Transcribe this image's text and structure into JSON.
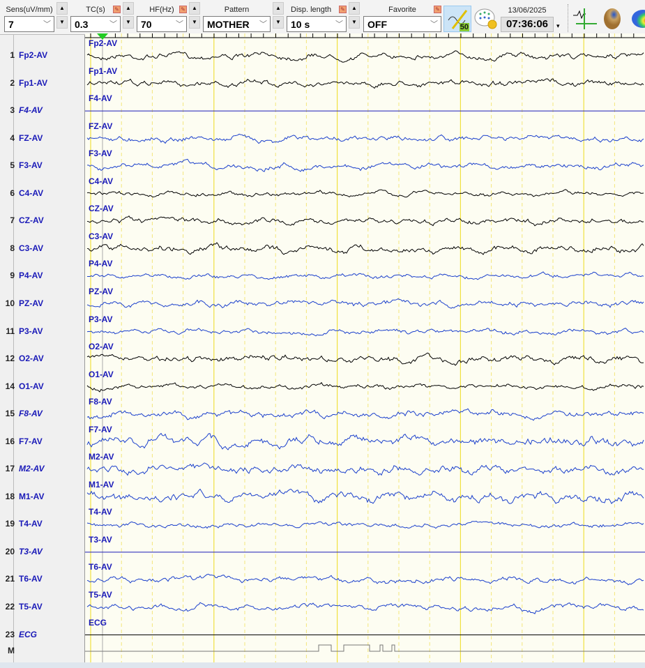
{
  "toolbar": {
    "sens": {
      "label": "Sens(uV/mm)",
      "value": "7"
    },
    "tc": {
      "label": "TC(s)",
      "value": "0.3"
    },
    "hf": {
      "label": "HF(Hz)",
      "value": "70"
    },
    "pattern": {
      "label": "Pattern",
      "value": "MOTHER"
    },
    "disp": {
      "label": "Disp. length",
      "value": "10 s"
    },
    "favorite": {
      "label": "Favorite",
      "value": "OFF"
    },
    "notch": "50",
    "date": "13/06/2025",
    "time": "07:36:06"
  },
  "channels": [
    {
      "num": "1",
      "name": "Fp2-AV",
      "trace": "Fp2-AV",
      "italic": false,
      "color": "#000000",
      "amp": 5
    },
    {
      "num": "2",
      "name": "Fp1-AV",
      "trace": "Fp1-AV",
      "italic": false,
      "color": "#000000",
      "amp": 5
    },
    {
      "num": "3",
      "name": "F4-AV",
      "trace": "F4-AV",
      "italic": true,
      "color": "#1a1ab8",
      "amp": 0
    },
    {
      "num": "4",
      "name": "FZ-AV",
      "trace": "FZ-AV",
      "italic": false,
      "color": "#1a3fcc",
      "amp": 5
    },
    {
      "num": "5",
      "name": "F3-AV",
      "trace": "F3-AV",
      "italic": false,
      "color": "#1a3fcc",
      "amp": 5
    },
    {
      "num": "6",
      "name": "C4-AV",
      "trace": "C4-AV",
      "italic": false,
      "color": "#000000",
      "amp": 4
    },
    {
      "num": "7",
      "name": "CZ-AV",
      "trace": "CZ-AV",
      "italic": false,
      "color": "#000000",
      "amp": 5
    },
    {
      "num": "8",
      "name": "C3-AV",
      "trace": "C3-AV",
      "italic": false,
      "color": "#000000",
      "amp": 6
    },
    {
      "num": "9",
      "name": "P4-AV",
      "trace": "P4-AV",
      "italic": false,
      "color": "#1a3fcc",
      "amp": 4
    },
    {
      "num": "10",
      "name": "PZ-AV",
      "trace": "PZ-AV",
      "italic": false,
      "color": "#1a3fcc",
      "amp": 5
    },
    {
      "num": "11",
      "name": "P3-AV",
      "trace": "P3-AV",
      "italic": false,
      "color": "#1a3fcc",
      "amp": 4
    },
    {
      "num": "12",
      "name": "O2-AV",
      "trace": "O2-AV",
      "italic": false,
      "color": "#000000",
      "amp": 6
    },
    {
      "num": "14",
      "name": "O1-AV",
      "trace": "O1-AV",
      "italic": false,
      "color": "#000000",
      "amp": 4
    },
    {
      "num": "15",
      "name": "F8-AV",
      "trace": "F8-AV",
      "italic": true,
      "color": "#1a3fcc",
      "amp": 6
    },
    {
      "num": "16",
      "name": "F7-AV",
      "trace": "F7-AV",
      "italic": false,
      "color": "#1a3fcc",
      "amp": 8
    },
    {
      "num": "17",
      "name": "M2-AV",
      "trace": "M2-AV",
      "italic": true,
      "color": "#1a3fcc",
      "amp": 7
    },
    {
      "num": "18",
      "name": "M1-AV",
      "trace": "M1-AV",
      "italic": false,
      "color": "#1a3fcc",
      "amp": 8
    },
    {
      "num": "19",
      "name": "T4-AV",
      "trace": "T4-AV",
      "italic": false,
      "color": "#1a3fcc",
      "amp": 4
    },
    {
      "num": "20",
      "name": "T3-AV",
      "trace": "T3-AV",
      "italic": true,
      "color": "#1a1ab8",
      "amp": 0
    },
    {
      "num": "21",
      "name": "T6-AV",
      "trace": "T6-AV",
      "italic": false,
      "color": "#1a3fcc",
      "amp": 5
    },
    {
      "num": "22",
      "name": "T5-AV",
      "trace": "T5-AV",
      "italic": false,
      "color": "#1a3fcc",
      "amp": 5
    },
    {
      "num": "23",
      "name": "ECG",
      "trace": "ECG",
      "italic": true,
      "color": "#000000",
      "amp": 0
    }
  ],
  "marker": {
    "label": "M"
  },
  "display_seconds": 10
}
